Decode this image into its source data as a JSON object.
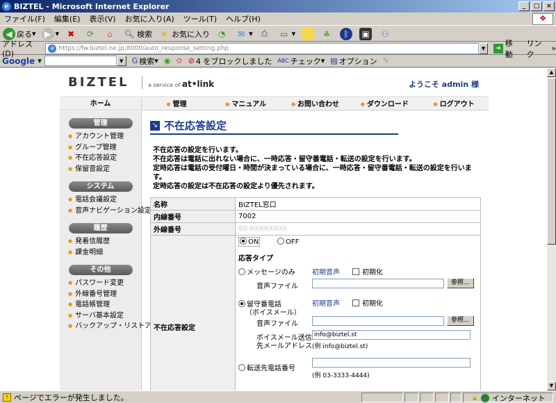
{
  "window": {
    "title": "BIZTEL - Microsoft Internet Explorer"
  },
  "menu": [
    "ファイル(F)",
    "編集(E)",
    "表示(V)",
    "お気に入り(A)",
    "ツール(T)",
    "ヘルプ(H)"
  ],
  "toolbar": {
    "back": "戻る",
    "search": "検索",
    "favorites": "お気に入り"
  },
  "address": {
    "label": "アドレス(D)",
    "url": "https://fw.biztel.ne.jp:8000/auto_response_setting.php",
    "go": "移動",
    "links": "リンク"
  },
  "google": {
    "logo": "Google",
    "search": "検索",
    "blocked": "4 をブロックしました",
    "check": "チェック",
    "options": "オプション"
  },
  "site": {
    "brand": "BIZTEL",
    "tagline_prefix": "a service of",
    "tagline_brand": "at•link",
    "welcome": "ようこそ admin 様",
    "nav": {
      "home": "ホーム",
      "items": [
        "管理",
        "マニュアル",
        "お問い合わせ",
        "ダウンロード",
        "ログアウト"
      ]
    },
    "sidebar": [
      {
        "header": "管理",
        "items": [
          "アカウント管理",
          "グループ管理",
          "不在応答設定",
          "保留音設定"
        ]
      },
      {
        "header": "システム",
        "items": [
          "電話会議設定",
          "音声ナビゲーション設定"
        ]
      },
      {
        "header": "履歴",
        "items": [
          "発着信履歴",
          "課金明細"
        ]
      },
      {
        "header": "その他",
        "items": [
          "パスワード変更",
          "外線番号管理",
          "電話帳管理",
          "サーバ基本設定",
          "バックアップ・リストア"
        ]
      }
    ],
    "page_title": "不在応答設定",
    "description": [
      "不在応答の設定を行います。",
      "不在応答は電話に出れない場合に、一時応答・留守番電話・転送の設定を行います。",
      "定時応答は電話の受付曜日・時間が決まっている場合に、一時応答・留守番電話・転送の設定を行います。",
      "定時応答の設定は不在応答の設定より優先されます。"
    ],
    "form": {
      "name_label": "名称",
      "name_value": "BIZTEL窓口",
      "ext_label": "内線番号",
      "ext_value": "7002",
      "outer_label": "外線番号",
      "outer_value": "03-XXXXXXXX",
      "setting_label": "不在応答設定",
      "on": "ON",
      "off": "OFF",
      "type_label": "応答タイプ",
      "message_only": "メッセージのみ",
      "initial_voice": "初期音声",
      "initialize": "初期化",
      "voice_file": "音声ファイル",
      "browse": "参照...",
      "voicemail_line1": "留守番電話",
      "voicemail_line2": "（ボイスメール）",
      "vm_send_label1": "ボイスメール送信",
      "vm_send_label2": "先メールアドレス",
      "vm_email": "info@biztel.st",
      "vm_example": "(例 info@biztel.st)",
      "forward_label": "転送先電話番号",
      "forward_example": "(例 03-3333-4444)"
    }
  },
  "status": {
    "message": "ページでエラーが発生しました。",
    "zone": "インターネット"
  }
}
